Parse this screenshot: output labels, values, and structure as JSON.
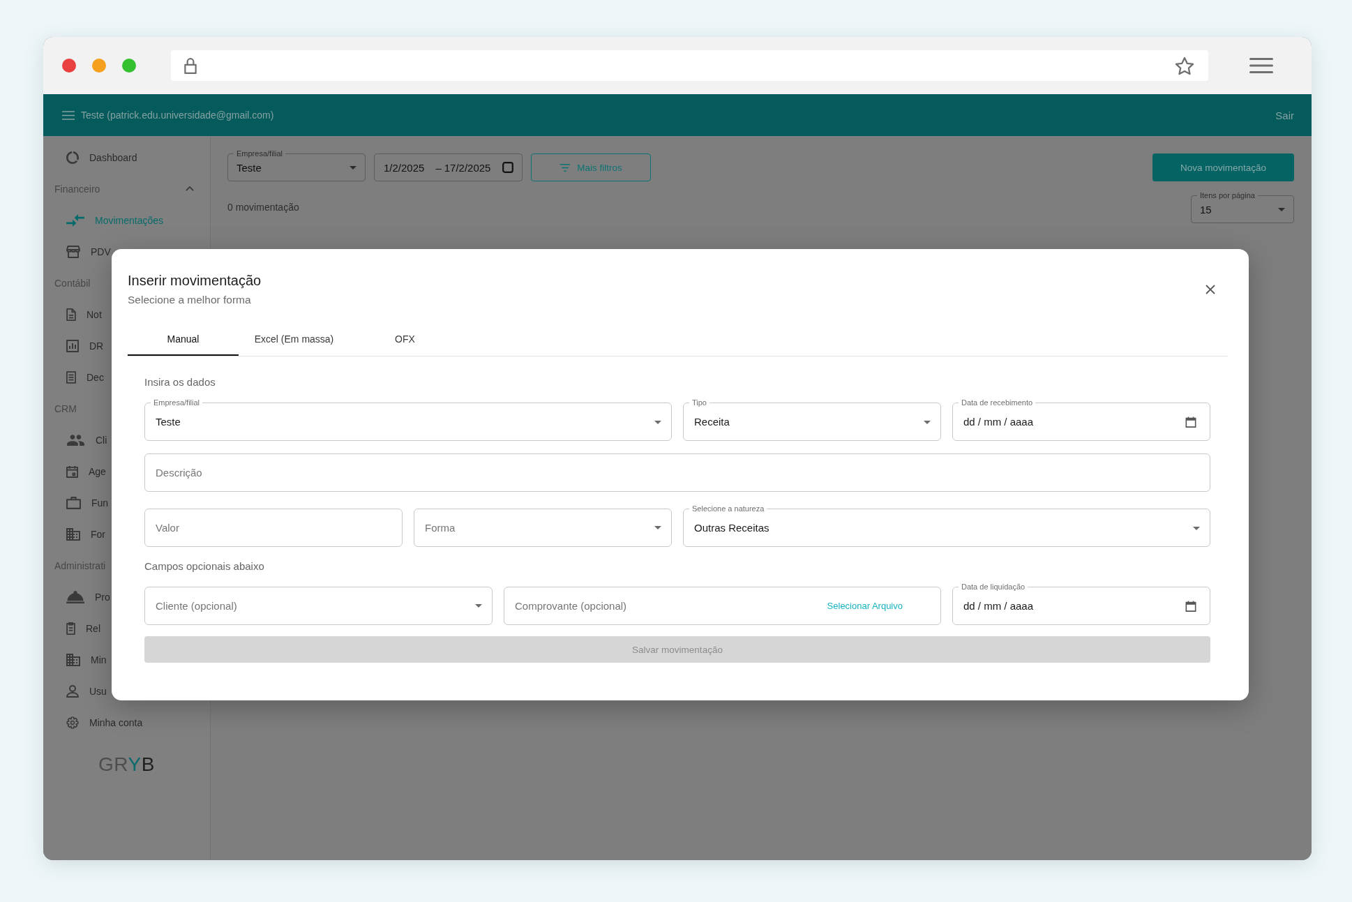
{
  "header": {
    "user": "Teste (patrick.edu.universidade@gmail.com)",
    "logout": "Sair"
  },
  "sidebar": {
    "items": [
      {
        "kind": "link",
        "label": "Dashboard",
        "selected": false
      },
      {
        "kind": "section",
        "label": "Financeiro",
        "expanded": true,
        "children": [
          {
            "label": "Movimentações",
            "selected": true
          },
          {
            "label": "PDV",
            "selected": false
          }
        ]
      },
      {
        "kind": "section",
        "label": "Contábil",
        "children": [
          {
            "label": "Not",
            "selected": false
          },
          {
            "label": "DR",
            "selected": false
          },
          {
            "label": "Dec",
            "selected": false
          }
        ]
      },
      {
        "kind": "section",
        "label": "CRM",
        "children": [
          {
            "label": "Cli",
            "selected": false
          },
          {
            "label": "Age",
            "selected": false
          },
          {
            "label": "Fun",
            "selected": false
          },
          {
            "label": "For",
            "selected": false
          }
        ]
      },
      {
        "kind": "section",
        "label": "Administrati",
        "children": [
          {
            "label": "Pro",
            "selected": false
          },
          {
            "label": "Rel",
            "selected": false
          },
          {
            "label": "Min",
            "selected": false
          },
          {
            "label": "Usu",
            "selected": false
          }
        ]
      },
      {
        "kind": "link",
        "label": "Minha conta",
        "selected": false
      }
    ],
    "logo": [
      {
        "text": "GR",
        "color": "#4d4d4d"
      },
      {
        "text": "Y",
        "color": "#0b6a6e"
      },
      {
        "text": "B",
        "color": "#1f1f1f"
      }
    ]
  },
  "toolbar": {
    "company": {
      "label": "Empresa/filial",
      "value": "Teste"
    },
    "date_range": {
      "start": "1/2/2025",
      "separator": "–",
      "end": "17/2/2025"
    },
    "more_filters": "Mais filtros",
    "new_button": "Nova movimentação"
  },
  "results": {
    "count": "0 movimentação",
    "per_page": {
      "label": "Itens por página",
      "value": "15"
    }
  },
  "modal": {
    "title": "Inserir movimentação",
    "subtitle": "Selecione a melhor forma",
    "tabs": [
      {
        "label": "Manual",
        "selected": true
      },
      {
        "label": "Excel (Em massa)",
        "selected": false
      },
      {
        "label": "OFX",
        "selected": false
      }
    ],
    "sections": [
      {
        "heading": "Insira os dados",
        "fields": [
          {
            "kind": "select",
            "label": "Empresa/filial",
            "value": "Teste"
          },
          {
            "kind": "select",
            "label": "Tipo",
            "value": "Receita"
          },
          {
            "kind": "date",
            "label": "Data de recebimento",
            "placeholder": "dd / mm / aaaa"
          },
          {
            "kind": "text",
            "placeholder": "Descrição"
          },
          {
            "kind": "text",
            "placeholder": "Valor"
          },
          {
            "kind": "select",
            "placeholder": "Forma"
          },
          {
            "kind": "select",
            "label": "Selecione a natureza",
            "value": "Outras Receitas"
          }
        ]
      },
      {
        "heading": "Campos opcionais abaixo",
        "fields": [
          {
            "kind": "select",
            "placeholder": "Cliente (opcional)"
          },
          {
            "kind": "file",
            "placeholder": "Comprovante (opcional)",
            "action": "Selecionar Arquivo"
          },
          {
            "kind": "date",
            "label": "Data de liquidação",
            "placeholder": "dd / mm / aaaa"
          }
        ]
      }
    ],
    "save_button": {
      "label": "Salvar movimentação",
      "disabled": true
    }
  }
}
